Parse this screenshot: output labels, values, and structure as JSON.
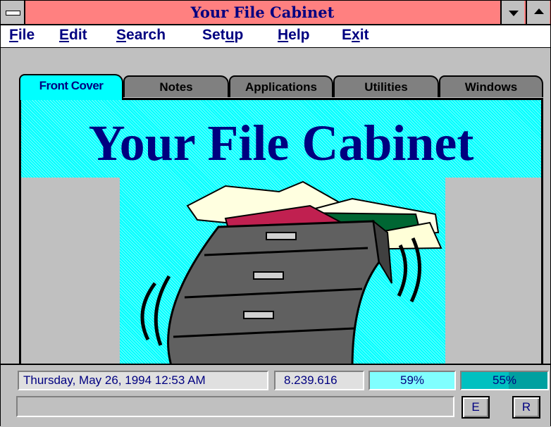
{
  "window": {
    "title": "Your File Cabinet",
    "colors": {
      "titlebar": "#ff8080",
      "accent": "#000080",
      "tab_active": "#00ffff",
      "panel": "#00ffff",
      "face": "#c0c0c0"
    }
  },
  "menu": {
    "items": [
      {
        "label_u": "F",
        "label_rest": "ile"
      },
      {
        "label_u": "E",
        "label_rest": "dit"
      },
      {
        "label_u": "S",
        "label_rest": "earch"
      },
      {
        "label_pre": "Set",
        "label_u": "u",
        "label_rest": "p"
      },
      {
        "label_u": "H",
        "label_rest": "elp"
      },
      {
        "label_pre": "E",
        "label_u": "x",
        "label_rest": "it"
      }
    ]
  },
  "tabs": [
    {
      "label": "Front Cover",
      "active": true
    },
    {
      "label": "Notes",
      "active": false
    },
    {
      "label": "Applications",
      "active": false
    },
    {
      "label": "Utilities",
      "active": false
    },
    {
      "label": "Windows",
      "active": false
    }
  ],
  "panel": {
    "title": "Your File Cabinet",
    "illustration": "file-cabinet-icon"
  },
  "status": {
    "datetime": "Thursday, May 26, 1994   12:53 AM",
    "memory": "8.239.616",
    "gauge1": {
      "label": "59%",
      "value": 59
    },
    "gauge2": {
      "label": "55%",
      "value": 55
    },
    "message": ""
  },
  "buttons": {
    "e_label": "E",
    "r_label": "R"
  }
}
